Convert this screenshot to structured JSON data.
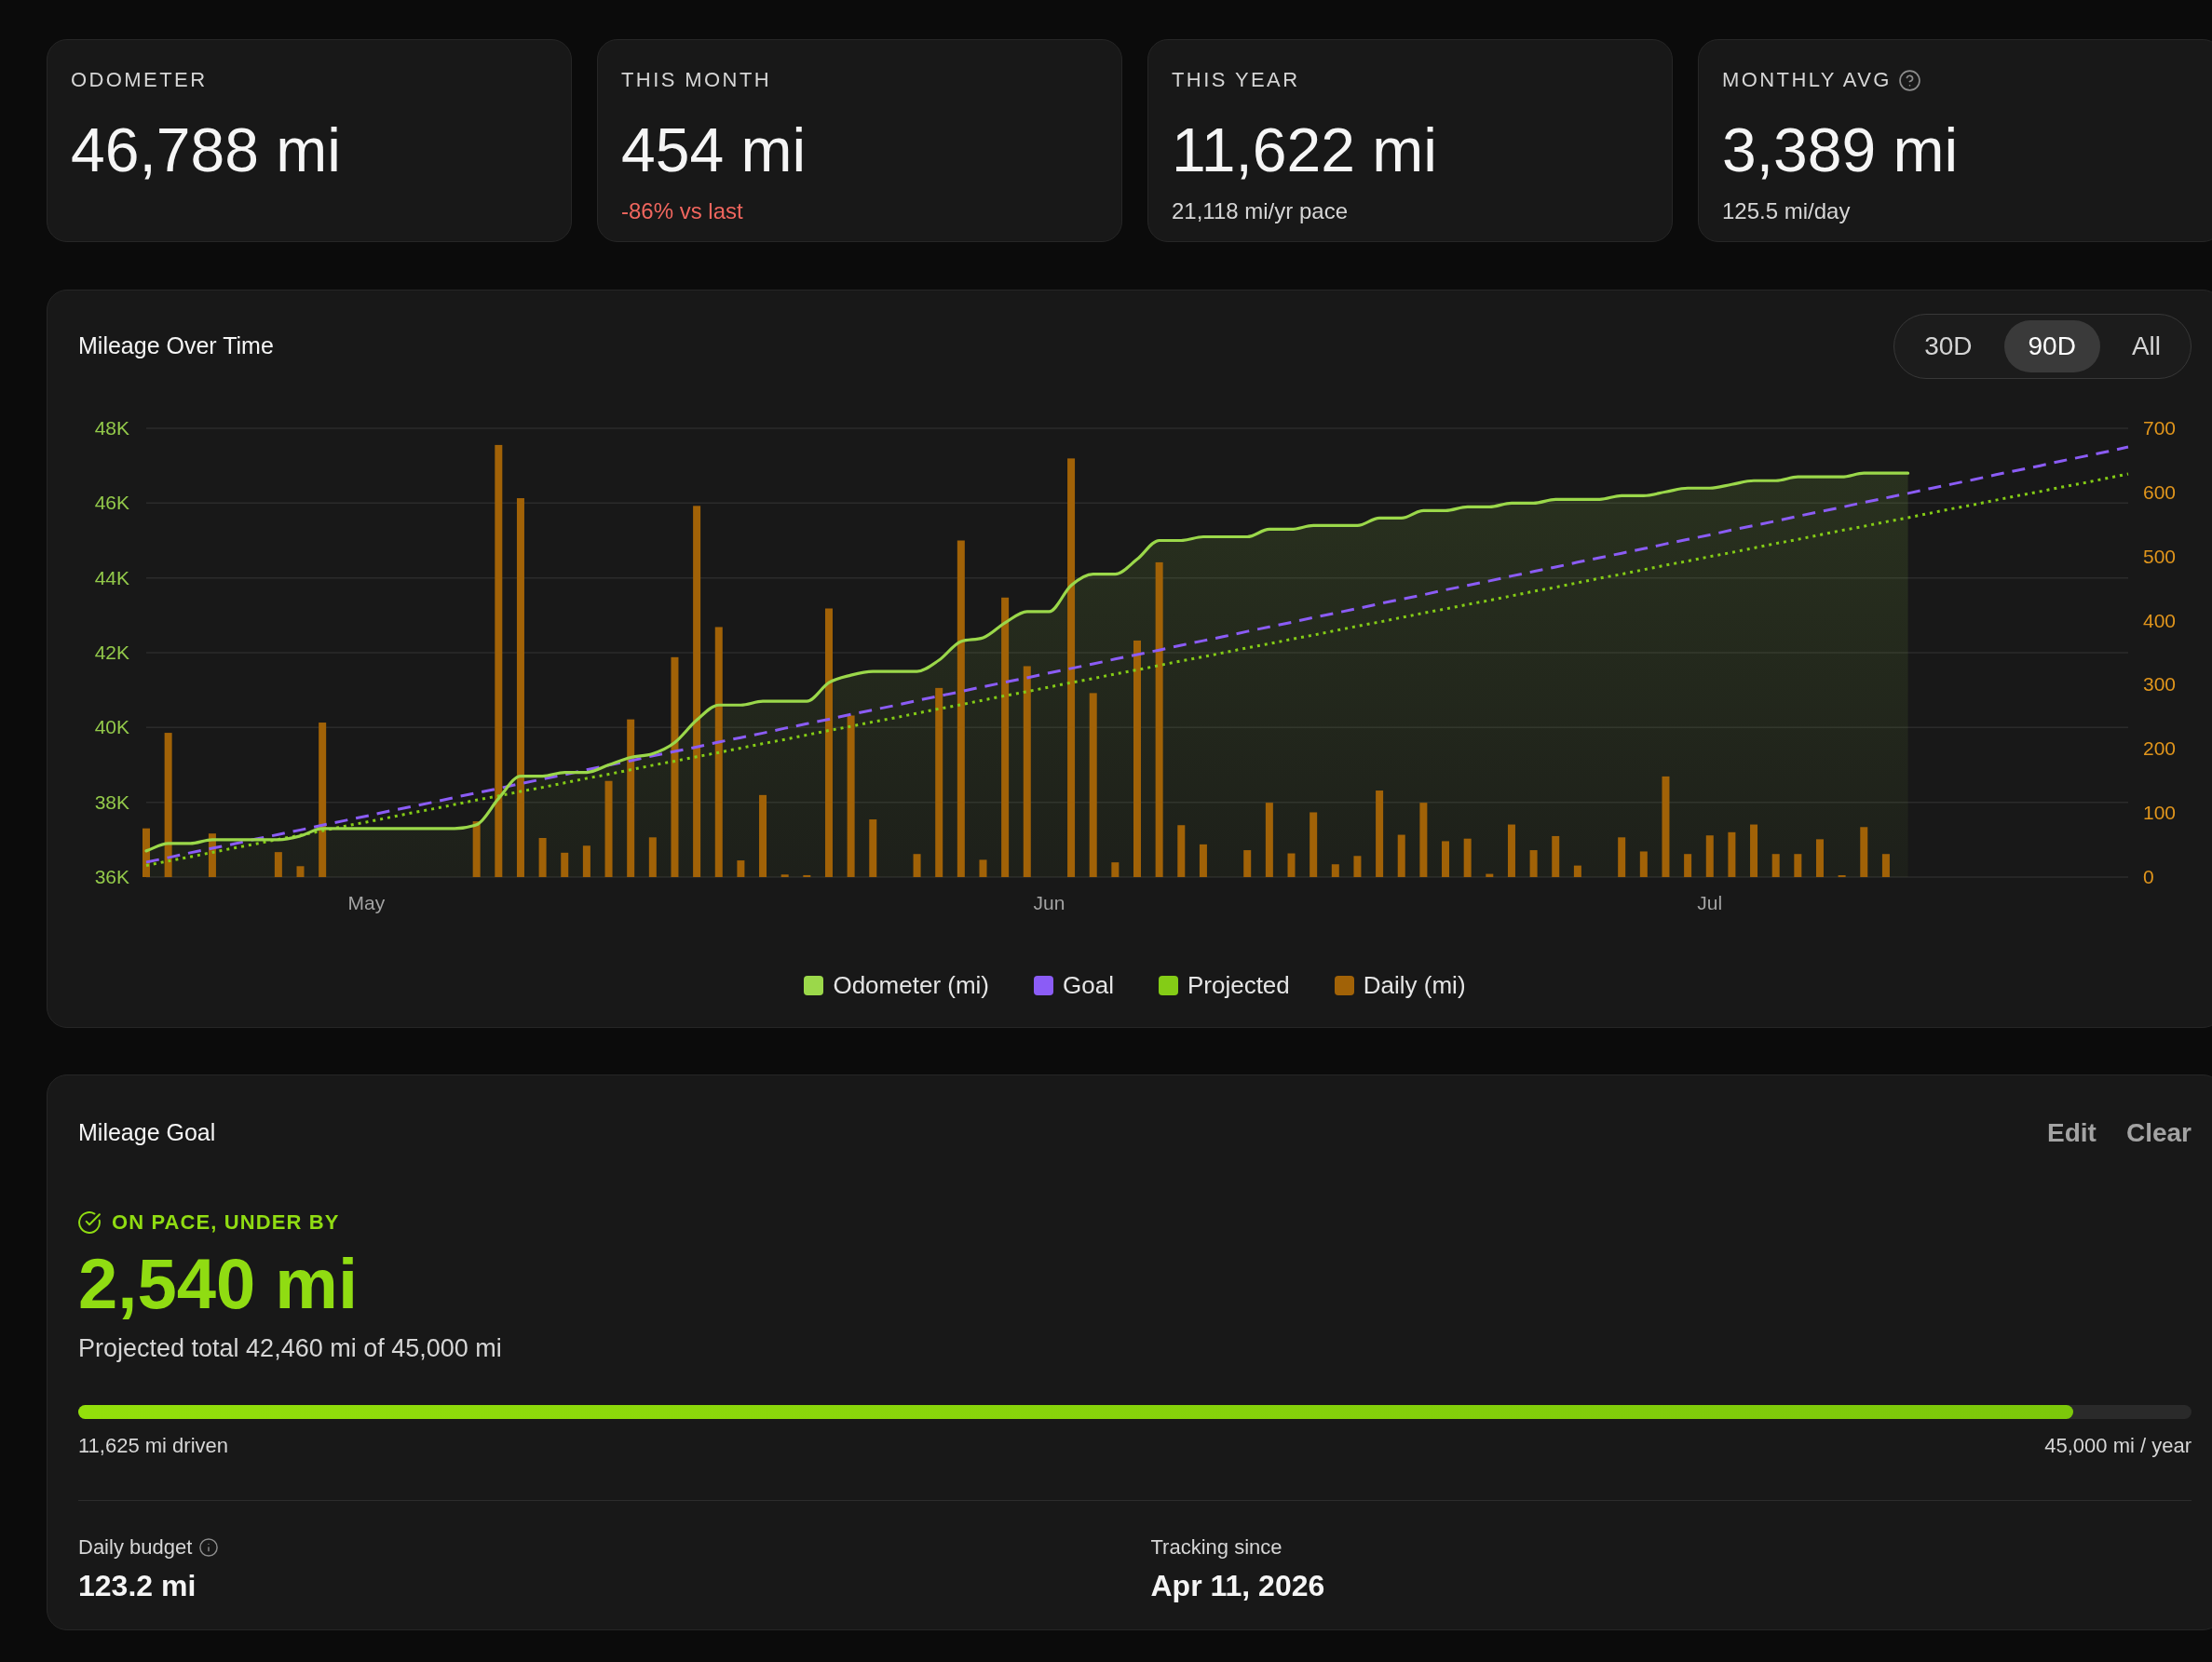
{
  "stats": [
    {
      "label": "ODOMETER",
      "value": "46,788 mi"
    },
    {
      "label": "THIS MONTH",
      "value": "454 mi",
      "note": "-86% vs last",
      "negative": true
    },
    {
      "label": "THIS YEAR",
      "value": "11,622 mi",
      "note": "21,118 mi/yr pace",
      "negative": false
    },
    {
      "label": "MONTHLY AVG",
      "hint": true,
      "value": "3,389 mi",
      "note": "125.5 mi/day",
      "negative": false
    }
  ],
  "mileage_chart": {
    "title": "Mileage Over Time",
    "ranges": [
      {
        "label": "30D",
        "selected": false
      },
      {
        "label": "90D",
        "selected": true
      },
      {
        "label": "All",
        "selected": false
      }
    ],
    "chart_data": {
      "type": "line",
      "grid": true,
      "legend": "bottom",
      "categories": [
        null,
        null,
        null,
        null,
        null,
        null,
        null,
        null,
        null,
        null,
        "May",
        null,
        null,
        null,
        null,
        null,
        null,
        null,
        null,
        null,
        null,
        null,
        null,
        null,
        null,
        null,
        null,
        null,
        null,
        null,
        null,
        null,
        null,
        null,
        null,
        null,
        null,
        null,
        null,
        null,
        null,
        "Jun",
        null,
        null,
        null,
        null,
        null,
        null,
        null,
        null,
        null,
        null,
        null,
        null,
        null,
        null,
        null,
        null,
        null,
        null,
        null,
        null,
        null,
        null,
        null,
        null,
        null,
        null,
        null,
        null,
        null,
        "Jul",
        null,
        null,
        null,
        null,
        null,
        null,
        null,
        null,
        null,
        null,
        null,
        null,
        null,
        null,
        null,
        null,
        null,
        null,
        null
      ],
      "ylim": [
        36000,
        48000
      ],
      "yticks": [
        {
          "value": 36000,
          "label": "36K"
        },
        {
          "value": 38000,
          "label": "38K"
        },
        {
          "value": 40000,
          "label": "40K"
        },
        {
          "value": 42000,
          "label": "42K"
        },
        {
          "value": 44000,
          "label": "44K"
        },
        {
          "value": 46000,
          "label": "46K"
        },
        {
          "value": 48000,
          "label": "48K"
        }
      ],
      "y2lim": [
        0,
        700
      ],
      "y2ticks": [
        0,
        100,
        200,
        300,
        400,
        500,
        600,
        700
      ],
      "series": [
        {
          "name": "Odometer (mi)",
          "type": "area",
          "color": "#9bd84a",
          "values": [
            36700,
            36900,
            36900,
            37000,
            37000,
            37000,
            37000,
            37100,
            37300,
            37300,
            37300,
            37300,
            37300,
            37300,
            37300,
            37400,
            38100,
            38700,
            38700,
            38800,
            38800,
            39000,
            39200,
            39300,
            39600,
            40200,
            40600,
            40600,
            40700,
            40700,
            40700,
            41200,
            41400,
            41500,
            41500,
            41500,
            41800,
            42300,
            42400,
            42800,
            43100,
            43100,
            43800,
            44100,
            44100,
            44500,
            45000,
            45000,
            45100,
            45100,
            45100,
            45300,
            45300,
            45400,
            45400,
            45400,
            45600,
            45600,
            45800,
            45800,
            45900,
            45900,
            46000,
            46000,
            46100,
            46100,
            46100,
            46200,
            46200,
            46300,
            46400,
            46400,
            46500,
            46600,
            46600,
            46700,
            46700,
            46700,
            46800,
            46800,
            46800,
            null,
            null,
            null,
            null,
            null,
            null,
            null,
            null,
            null,
            null
          ]
        },
        {
          "name": "Goal",
          "type": "line",
          "line_style": "dashed",
          "color": "#8b5cf6",
          "values": [
            36400,
            36520,
            36650,
            36770,
            36890,
            37020,
            37140,
            37260,
            37390,
            37510,
            37630,
            37760,
            37880,
            38000,
            38130,
            38250,
            38370,
            38500,
            38620,
            38740,
            38870,
            38990,
            39110,
            39240,
            39360,
            39480,
            39610,
            39730,
            39850,
            39980,
            40100,
            40220,
            40350,
            40470,
            40590,
            40720,
            40840,
            40960,
            41090,
            41210,
            41330,
            41460,
            41580,
            41700,
            41830,
            41950,
            42070,
            42200,
            42320,
            42440,
            42570,
            42690,
            42810,
            42940,
            43060,
            43180,
            43310,
            43430,
            43550,
            43680,
            43800,
            43920,
            44050,
            44170,
            44290,
            44420,
            44540,
            44660,
            44780,
            44910,
            45030,
            45150,
            45280,
            45400,
            45520,
            45650,
            45770,
            45890,
            46020,
            46140,
            46260,
            46390,
            46510,
            46630,
            46760,
            46880,
            47000,
            47130,
            47250,
            47370,
            47500
          ]
        },
        {
          "name": "Projected",
          "type": "line",
          "line_style": "dotted",
          "color": "#84cc16",
          "values": [
            36310,
            36430,
            36540,
            36660,
            36780,
            36890,
            37010,
            37120,
            37240,
            37360,
            37470,
            37590,
            37710,
            37820,
            37940,
            38060,
            38170,
            38290,
            38400,
            38520,
            38640,
            38750,
            38870,
            38990,
            39100,
            39220,
            39330,
            39450,
            39570,
            39680,
            39800,
            39920,
            40030,
            40150,
            40260,
            40380,
            40500,
            40610,
            40730,
            40850,
            40960,
            41080,
            41200,
            41310,
            41430,
            41540,
            41660,
            41780,
            41890,
            42010,
            42130,
            42240,
            42360,
            42470,
            42590,
            42710,
            42820,
            42940,
            43060,
            43170,
            43290,
            43400,
            43520,
            43640,
            43750,
            43870,
            43990,
            44100,
            44220,
            44340,
            44450,
            44570,
            44680,
            44800,
            44920,
            45030,
            45150,
            45270,
            45380,
            45500,
            45610,
            45730,
            45850,
            45960,
            46080,
            46200,
            46310,
            46430,
            46540,
            46660,
            46780
          ]
        },
        {
          "name": "Daily (mi)",
          "type": "bar",
          "axis": "y2",
          "color": "#a16207",
          "values": [
            76,
            225,
            0,
            68,
            0,
            0,
            39,
            17,
            241,
            0,
            0,
            0,
            0,
            0,
            0,
            87,
            674,
            591,
            61,
            38,
            49,
            150,
            246,
            62,
            343,
            579,
            390,
            26,
            128,
            4,
            3,
            419,
            252,
            90,
            0,
            36,
            295,
            525,
            27,
            436,
            329,
            0,
            653,
            287,
            23,
            369,
            491,
            81,
            51,
            0,
            42,
            116,
            37,
            101,
            20,
            33,
            135,
            66,
            116,
            56,
            60,
            5,
            82,
            42,
            64,
            18,
            0,
            62,
            40,
            157,
            36,
            65,
            70,
            82,
            36,
            36,
            59,
            1,
            78,
            36,
            0,
            null,
            null,
            null,
            null,
            null,
            null,
            null,
            null,
            null,
            null
          ]
        }
      ]
    }
  },
  "goal": {
    "title": "Mileage Goal",
    "actions": [
      "Edit",
      "Clear"
    ],
    "status": {
      "label": "ON PACE, UNDER BY",
      "on_pace": true
    },
    "amount": "2,540 mi",
    "summary": "Projected total 42,460 mi of 45,000 mi",
    "progress": {
      "level": 0.944,
      "driven": "11,625 mi driven",
      "target": "45,000 mi / year"
    },
    "stats": [
      {
        "label": "Daily budget",
        "hint": true,
        "value": "123.2 mi"
      },
      {
        "label": "Tracking since",
        "value": "Apr 11, 2026"
      }
    ]
  }
}
